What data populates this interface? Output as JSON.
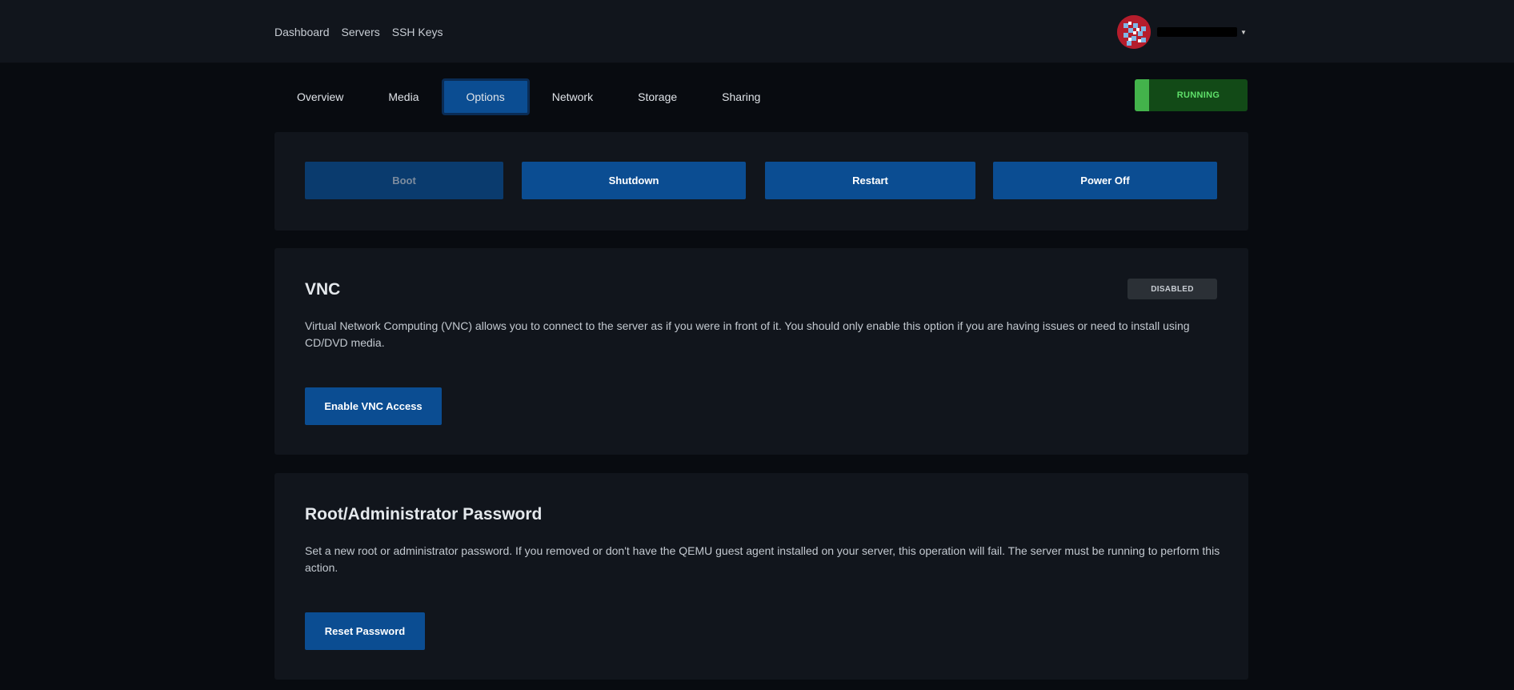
{
  "nav": {
    "items": [
      "Dashboard",
      "Servers",
      "SSH Keys"
    ]
  },
  "user": {
    "avatar": "pixel-avatar-icon"
  },
  "tabs": [
    {
      "label": "Overview"
    },
    {
      "label": "Media"
    },
    {
      "label": "Options",
      "active": true
    },
    {
      "label": "Network"
    },
    {
      "label": "Storage"
    },
    {
      "label": "Sharing"
    }
  ],
  "status": {
    "label": "RUNNING",
    "color": "#43b34b"
  },
  "power": {
    "boot": "Boot",
    "shutdown": "Shutdown",
    "restart": "Restart",
    "poweroff": "Power Off"
  },
  "vnc": {
    "title": "VNC",
    "badge": "DISABLED",
    "description": "Virtual Network Computing (VNC) allows you to connect to the server as if you were in front of it. You should only enable this option if you are having issues or need to install using CD/DVD media.",
    "button": "Enable VNC Access"
  },
  "password": {
    "title": "Root/Administrator Password",
    "description": "Set a new root or administrator password. If you removed or don't have the QEMU guest agent installed on your server, this operation will fail. The server must be running to perform this action.",
    "button": "Reset Password"
  },
  "colors": {
    "accent": "#0b4d92",
    "background": "#080b10",
    "card": "#11151c"
  }
}
